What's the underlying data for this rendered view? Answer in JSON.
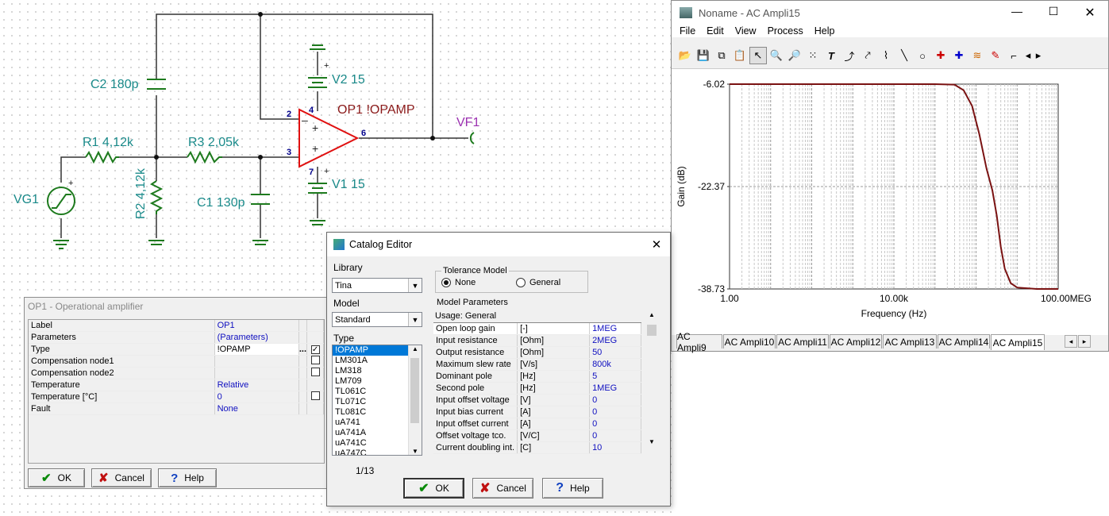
{
  "schematic": {
    "labels": {
      "c2": "C2 180p",
      "r1": "R1 4,12k",
      "r3": "R3 2,05k",
      "r2": "R2 4,12k",
      "c1": "C1 130p",
      "vg1": "VG1",
      "v2": "V2 15",
      "v1": "V1 15",
      "op1": "OP1 !OPAMP",
      "vf1": "VF1"
    },
    "pins": {
      "p2": "2",
      "p3": "3",
      "p4": "4",
      "p6": "6",
      "p7": "7"
    }
  },
  "ac_window": {
    "title": "Noname - AC Ampli15",
    "menu": [
      "File",
      "Edit",
      "View",
      "Process",
      "Help"
    ],
    "chart_data": {
      "type": "line",
      "ylabel": "Gain (dB)",
      "xlabel": "Frequency (Hz)",
      "x_scale": "log",
      "xlim": [
        1,
        100000000
      ],
      "ylim": [
        -38.73,
        -6.02
      ],
      "x_ticks": [
        "1.00",
        "10.00k",
        "100.00MEG"
      ],
      "y_ticks": [
        "-6.02",
        "-22.37",
        "-38.73"
      ],
      "grid": true,
      "series": [
        {
          "color": "#7a1212",
          "points": [
            [
              1,
              -6.02
            ],
            [
              100,
              -6.02
            ],
            [
              10000,
              -6.02
            ],
            [
              100000,
              -6.02
            ],
            [
              300000,
              -6.1
            ],
            [
              500000,
              -7.0
            ],
            [
              800000,
              -9.5
            ],
            [
              1200000,
              -14.0
            ],
            [
              1800000,
              -19.5
            ],
            [
              2500000,
              -23.0
            ],
            [
              3200000,
              -27.0
            ],
            [
              4000000,
              -32.0
            ],
            [
              5000000,
              -35.5
            ],
            [
              7000000,
              -37.8
            ],
            [
              10000000,
              -38.5
            ],
            [
              30000000,
              -38.73
            ],
            [
              100000000,
              -38.73
            ]
          ]
        }
      ]
    },
    "tabs": [
      "AC Ampli9",
      "AC Ampli10",
      "AC Ampli11",
      "AC Ampli12",
      "AC Ampli13",
      "AC Ampli14",
      "AC Ampli15"
    ],
    "active_tab": "AC Ampli15"
  },
  "props_window": {
    "title": "OP1 - Operational amplifier",
    "rows": [
      {
        "name": "Label",
        "value": "OP1",
        "check": ""
      },
      {
        "name": "Parameters",
        "value": "(Parameters)",
        "check": ""
      },
      {
        "name": "Type",
        "value": "!OPAMP",
        "check": "checked"
      },
      {
        "name": "Compensation node1",
        "value": "",
        "check": "empty"
      },
      {
        "name": "Compensation node2",
        "value": "",
        "check": "empty"
      },
      {
        "name": "Temperature",
        "value": "Relative",
        "check": ""
      },
      {
        "name": "Temperature [°C]",
        "value": "0",
        "check": "empty"
      },
      {
        "name": "Fault",
        "value": "None",
        "check": ""
      }
    ],
    "buttons": {
      "ok": "OK",
      "cancel": "Cancel",
      "help": "Help"
    }
  },
  "catalog": {
    "title": "Catalog Editor",
    "library_label": "Library",
    "library_value": "Tina",
    "model_label": "Model",
    "model_value": "Standard",
    "type_label": "Type",
    "types": [
      "!OPAMP",
      "LM301A",
      "LM318",
      "LM709",
      "TL061C",
      "TL071C",
      "TL081C",
      "uA741",
      "uA741A",
      "uA741C",
      "uA747C"
    ],
    "selected_type": "!OPAMP",
    "counter": "1/13",
    "tolerance_title": "Tolerance Model",
    "tol_none": "None",
    "tol_general": "General",
    "model_params_label": "Model Parameters",
    "usage": "Usage: General",
    "params": [
      {
        "name": "Open loop gain",
        "unit": "[-]",
        "value": "1MEG"
      },
      {
        "name": "Input resistance",
        "unit": "[Ohm]",
        "value": "2MEG"
      },
      {
        "name": "Output resistance",
        "unit": "[Ohm]",
        "value": "50"
      },
      {
        "name": "Maximum slew rate",
        "unit": "[V/s]",
        "value": "800k"
      },
      {
        "name": "Dominant pole",
        "unit": "[Hz]",
        "value": "5"
      },
      {
        "name": "Second pole",
        "unit": "[Hz]",
        "value": "1MEG"
      },
      {
        "name": "Input offset voltage",
        "unit": "[V]",
        "value": "0"
      },
      {
        "name": "Input bias current",
        "unit": "[A]",
        "value": "0"
      },
      {
        "name": "Input offset current",
        "unit": "[A]",
        "value": "0"
      },
      {
        "name": "Offset voltage tco.",
        "unit": "[V/C]",
        "value": "0"
      },
      {
        "name": "Current doubling int.",
        "unit": "[C]",
        "value": "10"
      }
    ],
    "buttons": {
      "ok": "OK",
      "cancel": "Cancel",
      "help": "Help"
    }
  }
}
